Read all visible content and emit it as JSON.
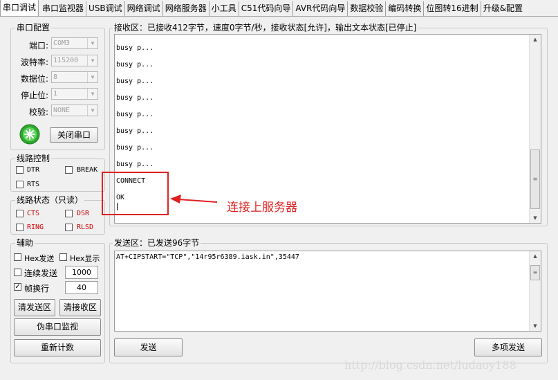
{
  "tabs": [
    "串口调试",
    "串口监视器",
    "USB调试",
    "网络调试",
    "网络服务器",
    "小工具",
    "C51代码向导",
    "AVR代码向导",
    "数据校验",
    "编码转换",
    "位图转16进制",
    "升级&配置"
  ],
  "serial_config": {
    "title": "串口配置",
    "port_label": "端口:",
    "port_value": "COM3",
    "baud_label": "波特率:",
    "baud_value": "115200",
    "databits_label": "数据位:",
    "databits_value": "8",
    "stopbits_label": "停止位:",
    "stopbits_value": "1",
    "parity_label": "校验:",
    "parity_value": "NONE",
    "close_button": "关闭串口"
  },
  "line_control": {
    "title": "线路控制",
    "dtr": "DTR",
    "break": "BREAK",
    "rts": "RTS"
  },
  "line_status": {
    "title": "线路状态（只读）",
    "cts": "CTS",
    "dsr": "DSR",
    "ring": "RING",
    "rlsd": "RLSD"
  },
  "aux": {
    "title": "辅助",
    "hex_send": "Hex发送",
    "hex_show": "Hex显示",
    "continuous_send": "连续发送",
    "interval_value": "1000",
    "frame_newline": "帧换行",
    "frame_value": "40",
    "clear_send": "清发送区",
    "clear_recv": "清接收区",
    "pseudo_monitor": "伪串口监视",
    "recount": "重新计数"
  },
  "receive": {
    "title": "接收区：已接收412字节，速度0字节/秒，接收状态[允许]，输出文本状态[已停止]",
    "lines": [
      "busy p...",
      "busy p...",
      "busy p...",
      "busy p...",
      "busy p...",
      "busy p...",
      "busy p...",
      "busy p...",
      "CONNECT",
      "OK"
    ]
  },
  "annotation": {
    "text": "连接上服务器",
    "color": "#e02020"
  },
  "send": {
    "title": "发送区：已发送96字节",
    "content": "AT+CIPSTART=\"TCP\",\"14r95r6389.iask.in\",35447",
    "send_button": "发送",
    "multi_send_button": "多项发送"
  },
  "watermark": "http://blog.csdn.net/ludaoy188"
}
